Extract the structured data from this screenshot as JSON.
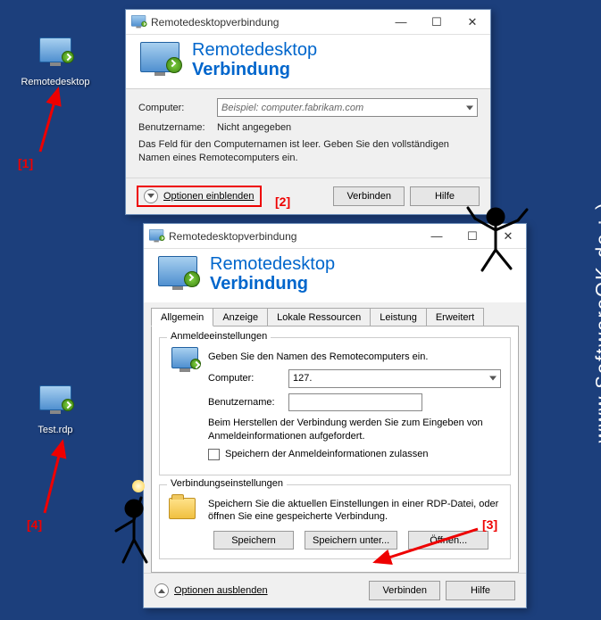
{
  "desktop": {
    "icon1_label": "Remotedesktop",
    "icon2_label": "Test.rdp"
  },
  "win1": {
    "title": "Remotedesktopverbindung",
    "header_line1": "Remotedesktop",
    "header_line2": "Verbindung",
    "computer_label": "Computer:",
    "computer_placeholder": "Beispiel: computer.fabrikam.com",
    "username_label": "Benutzername:",
    "username_value": "Nicht angegeben",
    "empty_note": "Das Feld für den Computernamen ist leer. Geben Sie den vollständigen Namen eines Remotecomputers ein.",
    "expand_label": "Optionen einblenden",
    "connect_btn": "Verbinden",
    "help_btn": "Hilfe"
  },
  "win2": {
    "title": "Remotedesktopverbindung",
    "header_line1": "Remotedesktop",
    "header_line2": "Verbindung",
    "tabs": [
      "Allgemein",
      "Anzeige",
      "Lokale Ressourcen",
      "Leistung",
      "Erweitert"
    ],
    "group1_legend": "Anmeldeeinstellungen",
    "group1_prompt": "Geben Sie den Namen des Remotecomputers ein.",
    "computer_label": "Computer:",
    "computer_value": "127.",
    "username_label": "Benutzername:",
    "username_value": "",
    "cred_note": "Beim Herstellen der Verbindung werden Sie zum Eingeben von Anmeldeinformationen aufgefordert.",
    "save_creds_label": "Speichern der Anmeldeinformationen zulassen",
    "group2_legend": "Verbindungseinstellungen",
    "group2_text": "Speichern Sie die aktuellen Einstellungen in einer RDP-Datei, oder öffnen Sie eine gespeicherte Verbindung.",
    "save_btn": "Speichern",
    "saveas_btn": "Speichern unter...",
    "open_btn": "Öffnen...",
    "collapse_label": "Optionen ausblenden",
    "connect_btn": "Verbinden",
    "help_btn": "Hilfe"
  },
  "annotations": {
    "a1": "[1]",
    "a2": "[2]",
    "a3": "[3]",
    "a4": "[4]"
  },
  "watermark": "www.SoftwareOK.de :-)"
}
